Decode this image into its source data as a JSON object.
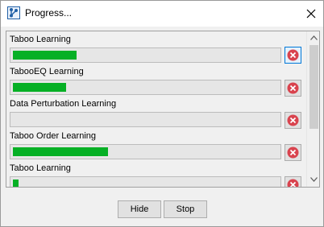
{
  "window": {
    "title": "Progress..."
  },
  "tasks": [
    {
      "label": "Taboo Learning",
      "progress_pct": 24
    },
    {
      "label": "TabooEQ Learning",
      "progress_pct": 20
    },
    {
      "label": "Data Perturbation Learning",
      "progress_pct": 0
    },
    {
      "label": "Taboo Order Learning",
      "progress_pct": 36
    },
    {
      "label": "Taboo Learning",
      "progress_pct": 2
    }
  ],
  "buttons": {
    "hide": "Hide",
    "stop": "Stop"
  },
  "icons": {
    "app": "network-graph-icon",
    "close": "close-icon",
    "cancel": "cancel-icon",
    "scroll_up": "chevron-up-icon",
    "scroll_down": "chevron-down-icon"
  },
  "colors": {
    "progress_fill": "#06b025",
    "cancel_red": "#d9434e",
    "focus_border": "#0078d7"
  }
}
